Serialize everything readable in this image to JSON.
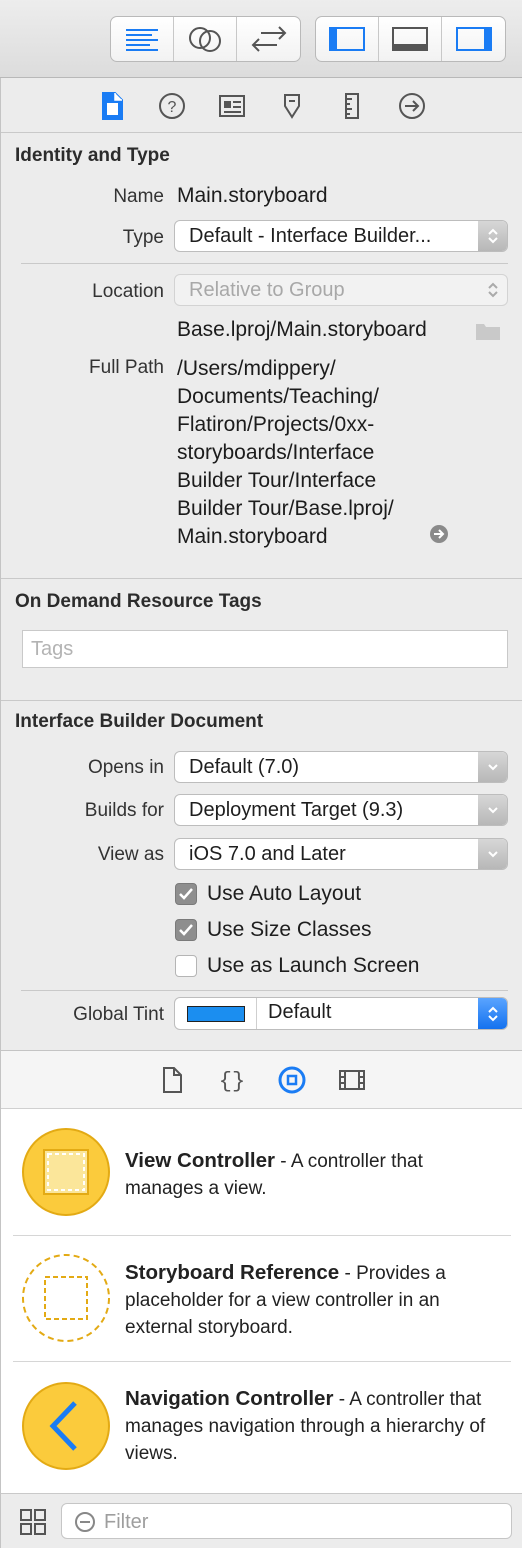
{
  "colors": {
    "accent": "#1a7cf4",
    "library_icon_yellow": "#fbcb3c",
    "tint_swatch": "#1b8ef0"
  },
  "toolbar": {
    "editor_group": [
      {
        "icon": "standard-editor-icon"
      },
      {
        "icon": "assistant-editor-icon"
      },
      {
        "icon": "version-editor-icon"
      }
    ],
    "view_group": [
      {
        "icon": "navigator-toggle-icon"
      },
      {
        "icon": "debug-area-toggle-icon"
      },
      {
        "icon": "utilities-toggle-icon"
      }
    ]
  },
  "inspector_tabs": [
    {
      "icon": "file-inspector-icon",
      "selected": true
    },
    {
      "icon": "quick-help-icon"
    },
    {
      "icon": "identity-inspector-icon"
    },
    {
      "icon": "attributes-inspector-icon"
    },
    {
      "icon": "size-inspector-icon"
    },
    {
      "icon": "connections-inspector-icon"
    }
  ],
  "identity": {
    "title": "Identity and Type",
    "name_label": "Name",
    "name_value": "Main.storyboard",
    "type_label": "Type",
    "type_value": "Default - Interface Builder...",
    "location_label": "Location",
    "location_value": "Relative to Group",
    "relative_path": "Base.lproj/Main.storyboard",
    "full_path_label": "Full Path",
    "full_path_lines": [
      "/Users/mdippery/",
      "Documents/Teaching/",
      "Flatiron/Projects/0xx-",
      "storyboards/Interface",
      "Builder Tour/Interface",
      "Builder Tour/Base.lproj/",
      "Main.storyboard"
    ]
  },
  "odr": {
    "title": "On Demand Resource Tags",
    "tags_placeholder": "Tags"
  },
  "ib_doc": {
    "title": "Interface Builder Document",
    "opens_in_label": "Opens in",
    "opens_in_value": "Default (7.0)",
    "builds_for_label": "Builds for",
    "builds_for_value": "Deployment Target (9.3)",
    "view_as_label": "View as",
    "view_as_value": "iOS 7.0 and Later",
    "checkboxes": [
      {
        "label": "Use Auto Layout",
        "checked": true
      },
      {
        "label": "Use Size Classes",
        "checked": true
      },
      {
        "label": "Use as Launch Screen",
        "checked": false
      }
    ],
    "global_tint_label": "Global Tint",
    "global_tint_value": "Default"
  },
  "library_tabs": [
    {
      "icon": "file-template-library-icon"
    },
    {
      "icon": "code-snippet-library-icon"
    },
    {
      "icon": "object-library-icon",
      "selected": true
    },
    {
      "icon": "media-library-icon"
    }
  ],
  "library_items": [
    {
      "title": "View Controller",
      "desc": " - A controller that manages a view.",
      "icon": "view-controller-icon"
    },
    {
      "title": "Storyboard Reference",
      "desc": " - Provides a placeholder for a view controller in an external storyboard.",
      "icon": "storyboard-reference-icon"
    },
    {
      "title": "Navigation Controller",
      "desc": " - A controller that manages navigation through a hierarchy of views.",
      "icon": "navigation-controller-icon"
    }
  ],
  "filter": {
    "placeholder": "Filter"
  }
}
